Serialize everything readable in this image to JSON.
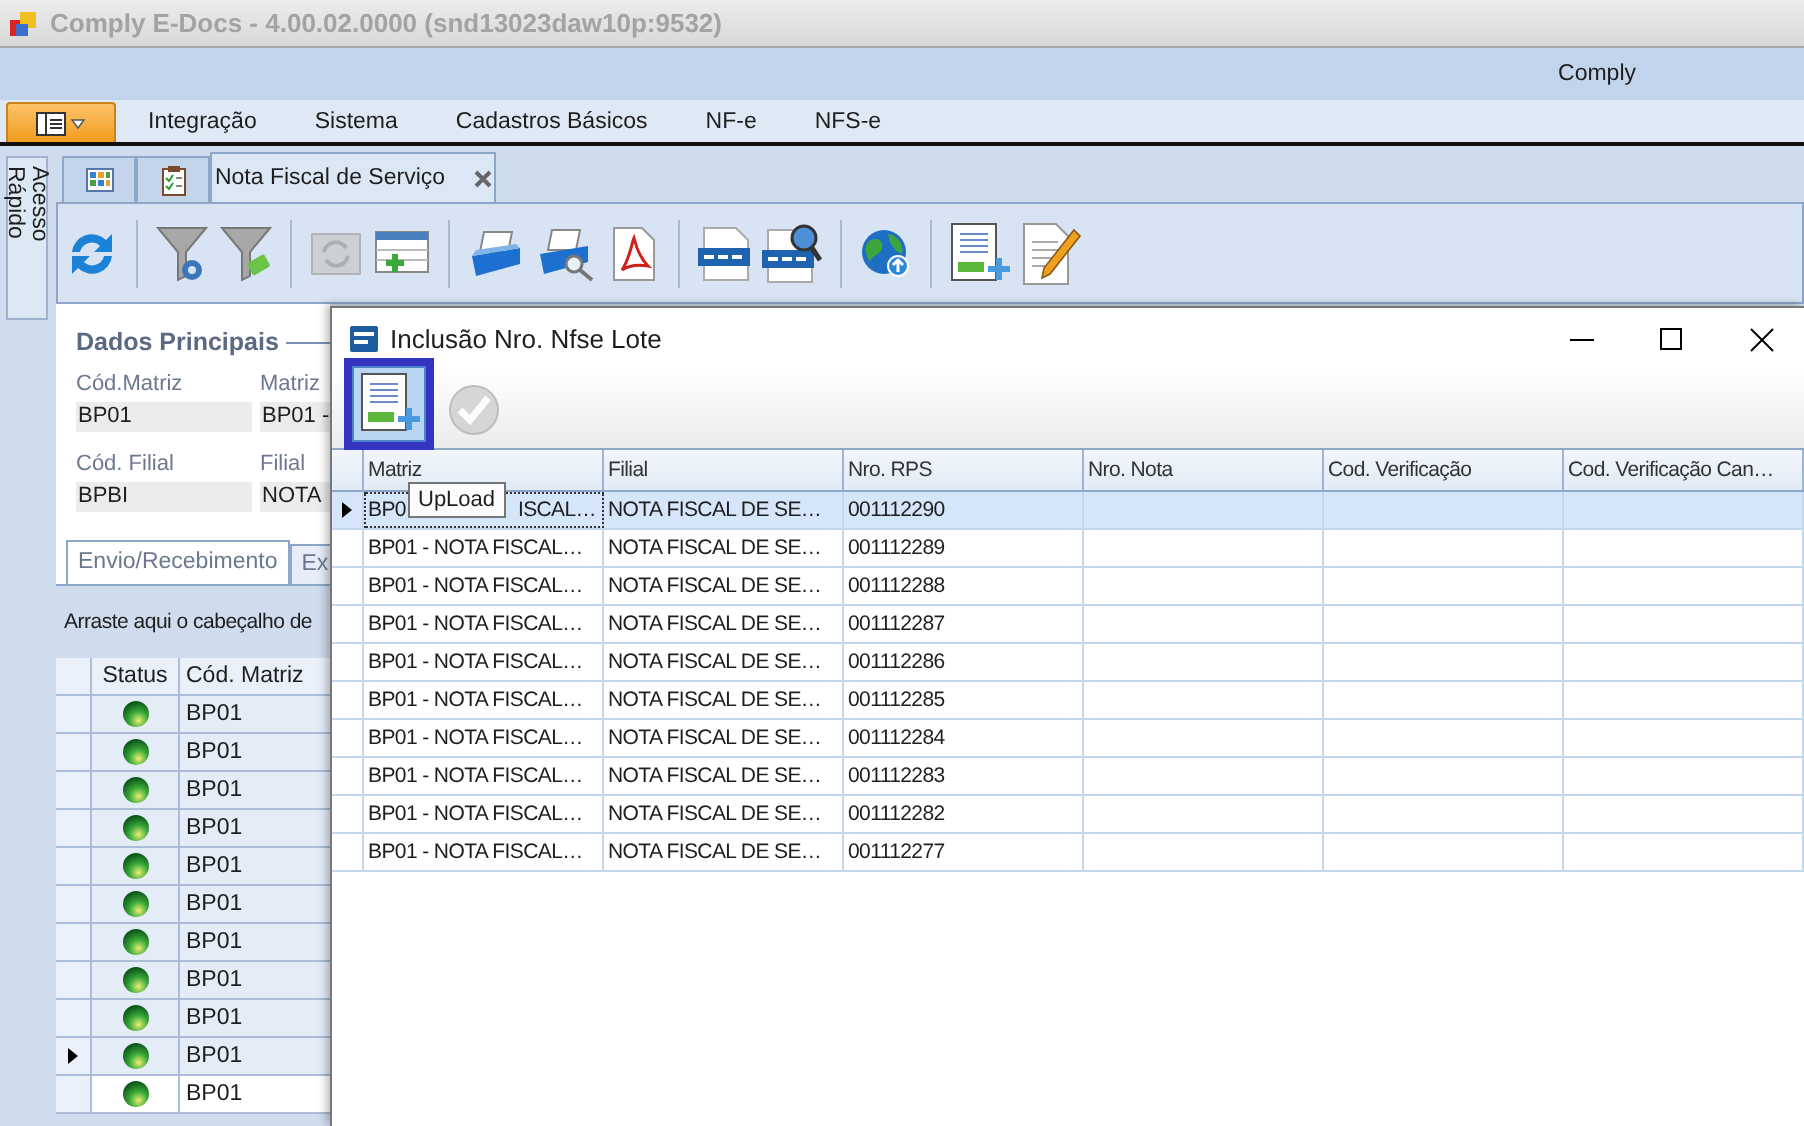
{
  "window": {
    "title": "Comply E-Docs - 4.00.02.0000 (snd13023daw10p:9532)"
  },
  "ribbon": {
    "caption": "Comply",
    "menu": [
      "Integração",
      "Sistema",
      "Cadastros Básicos",
      "NF-e",
      "NFS-e"
    ]
  },
  "side_panel": {
    "label": "Acesso Rápido"
  },
  "document_tabs": [
    {
      "kind": "grid",
      "selected": false
    },
    {
      "kind": "checklist",
      "selected": false
    },
    {
      "kind": "text",
      "label": "Nota Fiscal de Serviço",
      "selected": true
    }
  ],
  "toolbar": [
    [
      {
        "kind": "refresh",
        "disabled": false
      }
    ],
    [
      {
        "kind": "filter-gear",
        "disabled": false
      },
      {
        "kind": "filter-clear",
        "disabled": false
      }
    ],
    [
      {
        "kind": "sync-document",
        "disabled": true
      },
      {
        "kind": "table-add",
        "disabled": false
      }
    ],
    [
      {
        "kind": "printer",
        "disabled": false
      },
      {
        "kind": "print-preview",
        "disabled": false
      },
      {
        "kind": "pdf",
        "disabled": false
      }
    ],
    [
      {
        "kind": "xml",
        "disabled": false
      },
      {
        "kind": "xml-search",
        "disabled": false
      }
    ],
    [
      {
        "kind": "globe",
        "disabled": false
      }
    ],
    [
      {
        "kind": "document-add",
        "disabled": false
      },
      {
        "kind": "document-edit",
        "disabled": false
      }
    ]
  ],
  "main_form": {
    "title": "Dados Principais",
    "fields": [
      {
        "label": "Cód.Matriz",
        "value": "BP01"
      },
      {
        "label": "Matriz",
        "value": "BP01 -"
      },
      {
        "label": "Cód. Filial",
        "value": "BPBI"
      },
      {
        "label": "Filial",
        "value": "NOTA"
      }
    ]
  },
  "section_tabs": [
    {
      "label": "Envio/Recebimento",
      "selected": true
    },
    {
      "label": "Ex",
      "selected": false
    }
  ],
  "main_grid": {
    "group_hint": "Arraste aqui o cabeçalho de",
    "columns": [
      "Status",
      "Cód. Matriz"
    ],
    "rows": [
      {
        "cod_matriz": "BP01",
        "current": false
      },
      {
        "cod_matriz": "BP01",
        "current": false
      },
      {
        "cod_matriz": "BP01",
        "current": false
      },
      {
        "cod_matriz": "BP01",
        "current": false
      },
      {
        "cod_matriz": "BP01",
        "current": false
      },
      {
        "cod_matriz": "BP01",
        "current": false
      },
      {
        "cod_matriz": "BP01",
        "current": false
      },
      {
        "cod_matriz": "BP01",
        "current": false
      },
      {
        "cod_matriz": "BP01",
        "current": false
      },
      {
        "cod_matriz": "BP01",
        "current": true
      },
      {
        "cod_matriz": "BP01",
        "current": false
      }
    ]
  },
  "dialog": {
    "title": "Inclusão Nro. Nfse Lote",
    "toolbar": [
      {
        "kind": "upload",
        "disabled": false,
        "highlighted": true
      },
      {
        "kind": "confirm",
        "disabled": true,
        "highlighted": false
      }
    ],
    "tooltip": "UpLoad",
    "columns": [
      "Matriz",
      "Filial",
      "Nro. RPS",
      "Nro. Nota",
      "Cod. Verificação",
      "Cod. Verificação Can…"
    ],
    "rows": [
      {
        "matriz_parts": [
          "BP0",
          "ISCAL…"
        ],
        "filial": "NOTA FISCAL DE SE…",
        "rps": "001112290",
        "selected": true
      },
      {
        "matriz": "BP01 - NOTA FISCAL…",
        "filial": "NOTA FISCAL DE SE…",
        "rps": "001112289",
        "selected": false
      },
      {
        "matriz": "BP01 - NOTA FISCAL…",
        "filial": "NOTA FISCAL DE SE…",
        "rps": "001112288",
        "selected": false
      },
      {
        "matriz": "BP01 - NOTA FISCAL…",
        "filial": "NOTA FISCAL DE SE…",
        "rps": "001112287",
        "selected": false
      },
      {
        "matriz": "BP01 - NOTA FISCAL…",
        "filial": "NOTA FISCAL DE SE…",
        "rps": "001112286",
        "selected": false
      },
      {
        "matriz": "BP01 - NOTA FISCAL…",
        "filial": "NOTA FISCAL DE SE…",
        "rps": "001112285",
        "selected": false
      },
      {
        "matriz": "BP01 - NOTA FISCAL…",
        "filial": "NOTA FISCAL DE SE…",
        "rps": "001112284",
        "selected": false
      },
      {
        "matriz": "BP01 - NOTA FISCAL…",
        "filial": "NOTA FISCAL DE SE…",
        "rps": "001112283",
        "selected": false
      },
      {
        "matriz": "BP01 - NOTA FISCAL…",
        "filial": "NOTA FISCAL DE SE…",
        "rps": "001112282",
        "selected": false
      },
      {
        "matriz": "BP01 - NOTA FISCAL…",
        "filial": "NOTA FISCAL DE SE…",
        "rps": "001112277",
        "selected": false
      }
    ]
  }
}
